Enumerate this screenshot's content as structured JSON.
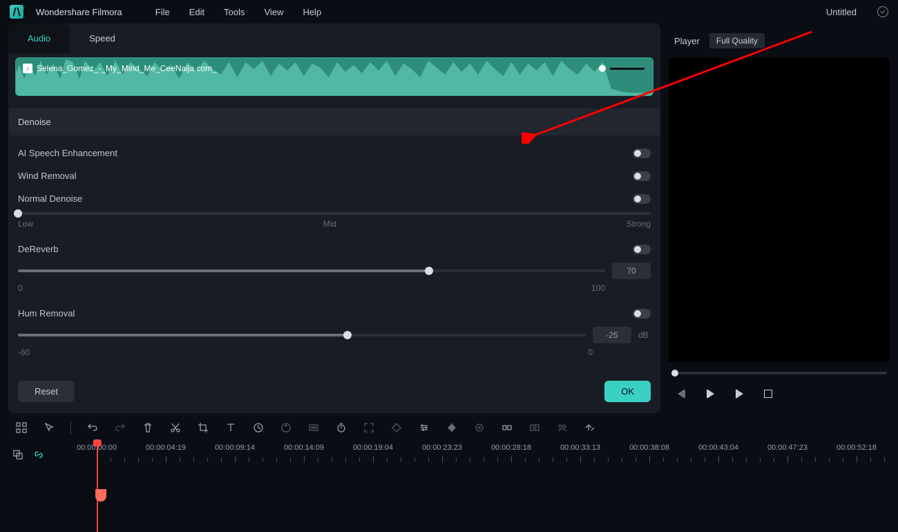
{
  "app": {
    "title": "Wondershare Filmora",
    "document": "Untitled"
  },
  "menu": [
    "File",
    "Edit",
    "Tools",
    "View",
    "Help"
  ],
  "panel": {
    "tabs": [
      {
        "label": "Audio",
        "active": true
      },
      {
        "label": "Speed",
        "active": false
      }
    ],
    "clipName": "Selena_Gomez_-_My_Mind_Me_CeeNaija.com_",
    "section": "Denoise",
    "items": {
      "ai_speech": {
        "label": "AI Speech Enhancement",
        "on": false
      },
      "wind": {
        "label": "Wind Removal",
        "on": false
      },
      "denoise": {
        "label": "Normal Denoise",
        "on": false,
        "min": "Low",
        "mid": "Mid",
        "max": "Strong",
        "value": 0
      },
      "dereverb": {
        "label": "DeReverb",
        "on": false,
        "min": "0",
        "max": "100",
        "display": "70",
        "value": 70
      },
      "hum": {
        "label": "Hum Removal",
        "on": false,
        "min": "-60",
        "max": "0",
        "display": "-25",
        "unit": "dB",
        "value": 58
      }
    },
    "buttons": {
      "reset": "Reset",
      "ok": "OK"
    }
  },
  "player": {
    "tabs": [
      {
        "label": "Player",
        "primary": true
      },
      {
        "label": "Full Quality",
        "primary": false
      }
    ]
  },
  "timeline": {
    "marks": [
      "00:00:00:00",
      "00:00:04:19",
      "00:00:09:14",
      "00:00:14:09",
      "00:00:19:04",
      "00:00:23:23",
      "00:00:28:18",
      "00:00:33:13",
      "00:00:38:08",
      "00:00:43:04",
      "00:00:47:23",
      "00:00:52:18"
    ],
    "playheadPx": 140,
    "trackMarkerPx": 140
  }
}
